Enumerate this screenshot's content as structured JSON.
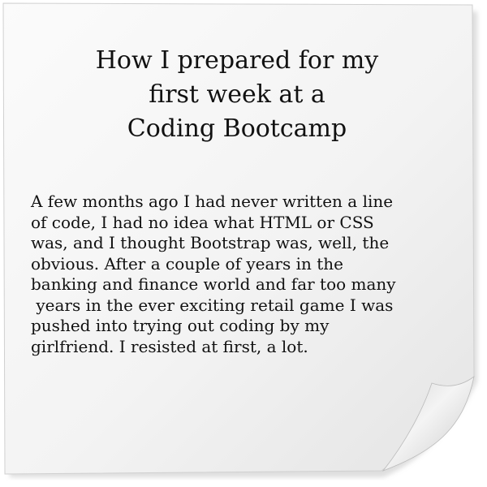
{
  "title": {
    "lines": [
      "How I prepared for my",
      "first week at a",
      "Coding Bootcamp"
    ]
  },
  "body": {
    "lines": [
      "A few months ago I had never written a line",
      "of code, I had no idea what HTML or CSS",
      "was, and I thought Bootstrap was, well, the",
      "obvious. After a couple of years in the",
      "banking and finance world and far too many",
      " years in the ever exciting retail game I was",
      "pushed into trying out coding by my",
      "girlfriend. I resisted at first, a lot."
    ]
  },
  "colors": {
    "paper": "#f7f7f7",
    "text": "#111111",
    "curl": "#e6e6e6"
  }
}
